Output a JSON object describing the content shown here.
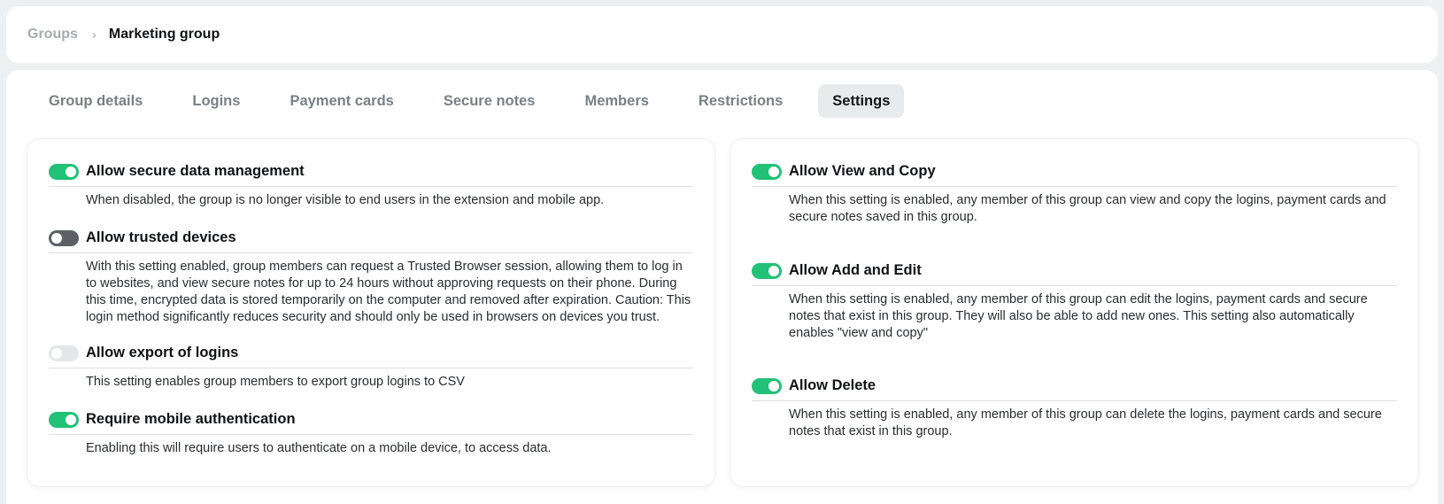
{
  "breadcrumb": {
    "parent": "Groups",
    "separator": "›",
    "current": "Marketing group"
  },
  "tabs": [
    {
      "label": "Group details",
      "active": false
    },
    {
      "label": "Logins",
      "active": false
    },
    {
      "label": "Payment cards",
      "active": false
    },
    {
      "label": "Secure notes",
      "active": false
    },
    {
      "label": "Members",
      "active": false
    },
    {
      "label": "Restrictions",
      "active": false
    },
    {
      "label": "Settings",
      "active": true
    }
  ],
  "colors": {
    "toggle_on": "#21c277",
    "toggle_off_dark": "#5d6166",
    "toggle_off_light": "#e4e6e8"
  },
  "left_settings": [
    {
      "title": "Allow secure data management",
      "state": "on",
      "description": "When disabled, the group is no longer visible to end users in the extension and mobile app."
    },
    {
      "title": "Allow trusted devices",
      "state": "off",
      "description": "With this setting enabled, group members can request a Trusted Browser session, allowing them to log in to websites, and view secure notes for up to 24 hours without approving requests on their phone. During this time, encrypted data is stored temporarily on the computer and removed after expiration. Caution: This login method significantly reduces security and should only be used in browsers on devices you trust."
    },
    {
      "title": "Allow export of logins",
      "state": "disabled",
      "description": "This setting enables group members to export group logins to CSV"
    },
    {
      "title": "Require mobile authentication",
      "state": "on",
      "description": "Enabling this will require users to authenticate on a mobile device, to access data."
    }
  ],
  "right_settings": [
    {
      "title": "Allow View and Copy",
      "state": "on",
      "description": "When this setting is enabled, any member of this group can view and copy the logins, payment cards and secure notes saved in this group."
    },
    {
      "title": "Allow Add and Edit",
      "state": "on",
      "description": "When this setting is enabled, any member of this group can edit the logins, payment cards and secure notes that exist in this group. They will also be able to add new ones. This setting also automatically enables \"view and copy\""
    },
    {
      "title": "Allow Delete",
      "state": "on",
      "description": "When this setting is enabled, any member of this group can delete the logins, payment cards and secure notes that exist in this group."
    }
  ]
}
